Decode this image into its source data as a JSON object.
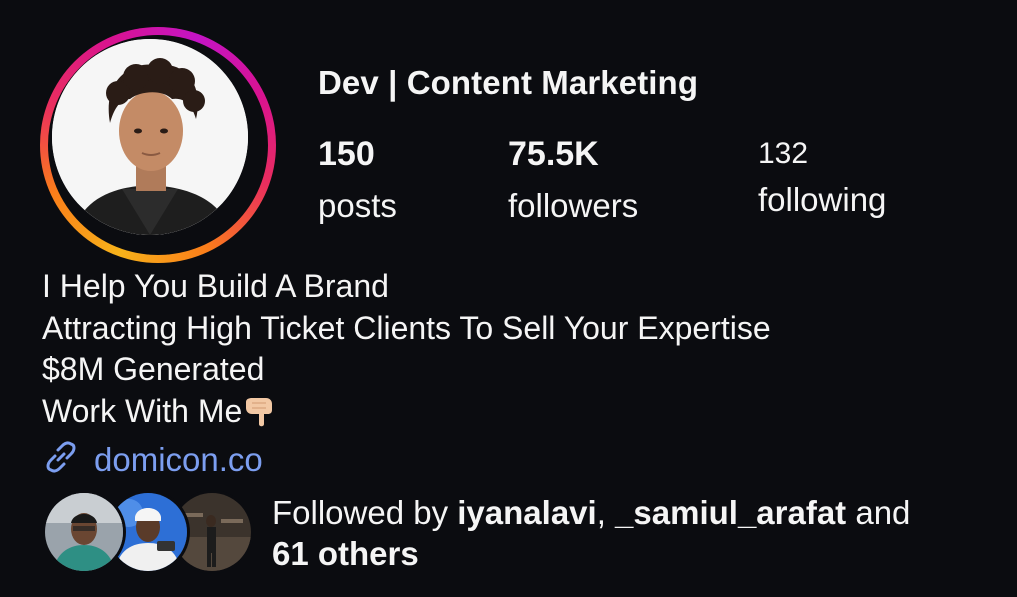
{
  "profile": {
    "display_name": "Dev | Content Marketing",
    "stats": {
      "posts_count": "150",
      "posts_label": "posts",
      "followers_count": "75.5K",
      "followers_label": "followers",
      "following_count": "132",
      "following_label": "following"
    },
    "bio": {
      "line1": "I Help You Build A Brand",
      "line2": "Attracting High Ticket Clients To Sell Your Expertise",
      "line3": "$8M Generated",
      "line4": "Work With Me",
      "line4_emoji": "backhand-index-pointing-down"
    },
    "link": {
      "icon": "link-icon",
      "text": "domicon.co"
    },
    "followed_by": {
      "prefix": "Followed by ",
      "user1": "iyanalavi",
      "separator": ", ",
      "user2": "_samiul_arafat",
      "conjunction": " and",
      "others": "61 others"
    }
  },
  "colors": {
    "background": "#0b0c10",
    "text": "#f5f5f5",
    "link": "#7c9ef0",
    "ring_start": "#f7b21a",
    "ring_mid": "#ea2e5e",
    "ring_end": "#c414c5"
  }
}
